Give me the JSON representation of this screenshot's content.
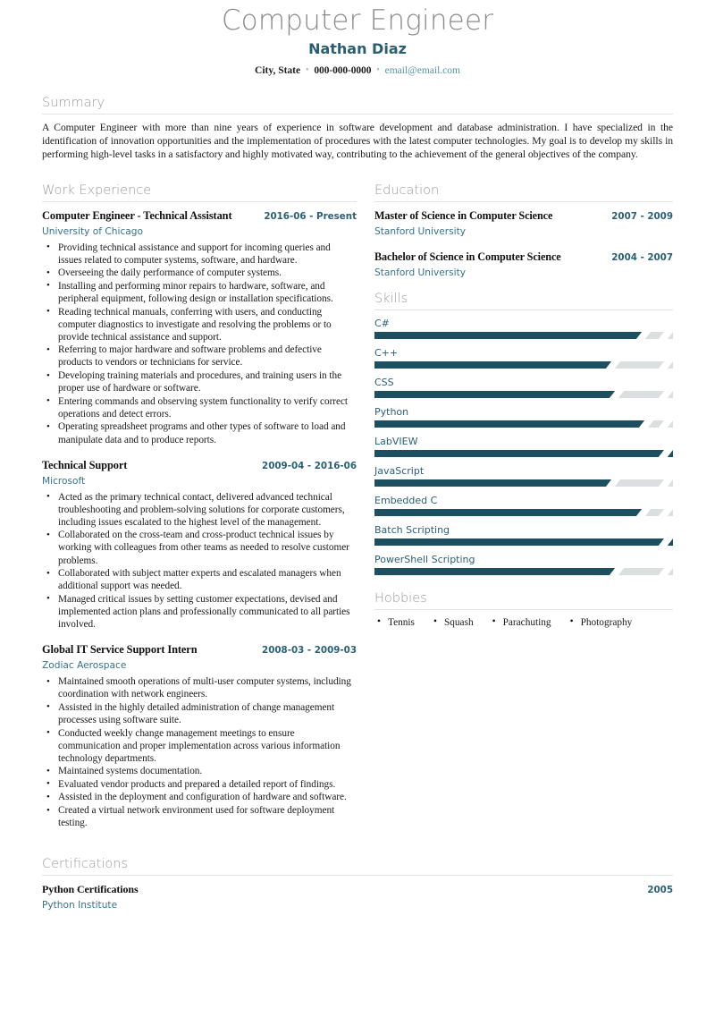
{
  "header": {
    "title": "Computer Engineer",
    "name": "Nathan Diaz",
    "location": "City, State",
    "phone": "000-000-0000",
    "email": "email@email.com",
    "separator": "•"
  },
  "summary": {
    "heading": "Summary",
    "text": "A Computer Engineer with more than nine years of experience in software development and database administration. I have specialized in the identification of innovation opportunities and the implementation of procedures with the latest computer technologies. My goal is to develop my skills in performing high-level tasks in a satisfactory and highly motivated way, contributing to the achievement of the general objectives of the company."
  },
  "work_experience": {
    "heading": "Work Experience",
    "entries": [
      {
        "title": "Computer Engineer - Technical Assistant",
        "date": "2016-06 - Present",
        "organization": "University of Chicago",
        "bullets": [
          "Providing technical assistance and support for incoming queries and issues related to computer systems, software, and hardware.",
          "Overseeing the daily performance of computer systems.",
          "Installing and performing minor repairs to hardware, software, and peripheral equipment, following design or installation specifications.",
          "Reading technical manuals, conferring with users, and conducting computer diagnostics to investigate and resolving the problems or to provide technical assistance and support.",
          "Referring to major hardware and software problems and defective products to vendors or technicians for service.",
          "Developing training materials and procedures, and training users in the proper use of hardware or software.",
          "Entering commands and observing system functionality to verify correct operations and detect errors.",
          "Operating spreadsheet programs and other types of software to load and manipulate data and to produce reports."
        ]
      },
      {
        "title": "Technical Support",
        "date": "2009-04 - 2016-06",
        "organization": "Microsoft",
        "bullets": [
          "Acted as the primary technical contact, delivered advanced technical troubleshooting and problem-solving solutions for corporate customers, including issues escalated to the highest level of the management.",
          "Collaborated on the cross-team and cross-product technical issues by working with colleagues from other teams as needed to resolve customer problems.",
          "Collaborated with subject matter experts and escalated managers when additional support was needed.",
          "Managed critical issues by setting customer expectations, devised and implemented action plans and professionally communicated to all parties involved."
        ]
      },
      {
        "title": "Global IT Service Support Intern",
        "date": "2008-03 - 2009-03",
        "organization": "Zodiac Aerospace",
        "bullets": [
          "Maintained smooth operations of multi-user computer systems, including coordination with network engineers.",
          "Assisted in the highly detailed administration of change management processes using software suite.",
          "Conducted weekly change management meetings to ensure communication and proper implementation across various information technology departments.",
          "Maintained systems documentation.",
          "Evaluated vendor products and prepared a detailed report of findings.",
          "Assisted in the deployment and configuration of hardware and software.",
          "Created a virtual network environment used for software deployment testing."
        ]
      }
    ]
  },
  "education": {
    "heading": "Education",
    "entries": [
      {
        "degree": "Master of Science in Computer Science",
        "date": "2007 - 2009",
        "school": "Stanford University"
      },
      {
        "degree": "Bachelor of Science in Computer Science",
        "date": "2004 - 2007",
        "school": "Stanford University"
      }
    ]
  },
  "skills": {
    "heading": "Skills",
    "items": [
      {
        "name": "C#",
        "level": 90
      },
      {
        "name": "C++",
        "level": 80
      },
      {
        "name": "CSS",
        "level": 81
      },
      {
        "name": "Python",
        "level": 91
      },
      {
        "name": "LabVIEW",
        "level": 100
      },
      {
        "name": "JavaScript",
        "level": 80
      },
      {
        "name": "Embedded C",
        "level": 90
      },
      {
        "name": "Batch Scripting",
        "level": 100
      },
      {
        "name": "PowerShell Scripting",
        "level": 81
      }
    ]
  },
  "hobbies": {
    "heading": "Hobbies",
    "items": [
      "Tennis",
      "Squash",
      "Parachuting",
      "Photography"
    ]
  },
  "certifications": {
    "heading": "Certifications",
    "entries": [
      {
        "title": "Python Certifications",
        "date": "2005",
        "organization": "Python Institute"
      }
    ]
  },
  "colors": {
    "accent": "#1c4f60",
    "link": "#36728c",
    "heading_gray": "#9b9b9b",
    "title_gray": "#8c8c8c",
    "track": "#dcdfe0"
  }
}
